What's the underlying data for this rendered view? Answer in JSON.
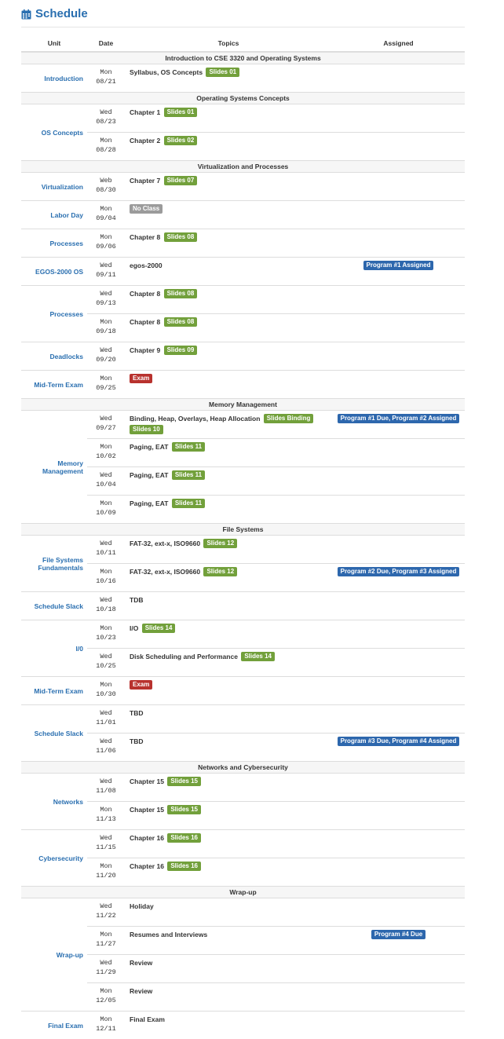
{
  "header": {
    "title": "Schedule",
    "icon": "calendar-icon",
    "accent": "#2a6fb0"
  },
  "columns": {
    "unit": "Unit",
    "date": "Date",
    "topics": "Topics",
    "assigned": "Assigned"
  },
  "colors": {
    "slides": "#72a03b",
    "no_class": "#9b9b9b",
    "exam": "#b8322e",
    "program": "#2d67ad"
  },
  "sections": {
    "s1": "Introduction to CSE 3320 and Operating Systems",
    "s2": "Operating Systems Concepts",
    "s3": "Virtualization and Processes",
    "s4": "Memory Management",
    "s5": "File Systems",
    "s6": "Networks and Cybersecurity",
    "s7": "Wrap-up"
  },
  "units": {
    "u1": "Introduction",
    "u2": "OS Concepts",
    "u3": "Virtualization",
    "u4": "Labor Day",
    "u5": "Processes",
    "u6": "EGOS-2000 OS",
    "u7": "Processes",
    "u8": "Deadlocks",
    "u9": "Mid-Term Exam",
    "u10a": "Memory",
    "u10b": "Management",
    "u11a": "File Systems",
    "u11b": "Fundamentals",
    "u12": "Schedule Slack",
    "u13": "I/0",
    "u14": "Mid-Term Exam",
    "u15": "Schedule Slack",
    "u16": "Networks",
    "u17": "Cybersecurity",
    "u18": "Wrap-up",
    "u19": "Final Exam"
  },
  "rows": {
    "r1": {
      "day": "Mon",
      "date": "08/21",
      "topic": "Syllabus, OS Concepts",
      "label": "Slides 01"
    },
    "r2": {
      "day": "Wed",
      "date": "08/23",
      "topic": "Chapter 1",
      "label": "Slides 01"
    },
    "r3": {
      "day": "Mon",
      "date": "08/28",
      "topic": "Chapter 2",
      "label": "Slides 02"
    },
    "r4": {
      "day": "Web",
      "date": "08/30",
      "topic": "Chapter 7",
      "label": "Slides 07"
    },
    "r5": {
      "day": "Mon",
      "date": "09/04",
      "label": "No Class"
    },
    "r6": {
      "day": "Mon",
      "date": "09/06",
      "topic": "Chapter 8",
      "label": "Slides 08"
    },
    "r7": {
      "day": "Wed",
      "date": "09/11",
      "topic": "egos-2000",
      "assigned": "Program #1 Assigned"
    },
    "r8": {
      "day": "Wed",
      "date": "09/13",
      "topic": "Chapter 8",
      "label": "Slides 08"
    },
    "r9": {
      "day": "Mon",
      "date": "09/18",
      "topic": "Chapter 8",
      "label": "Slides 08"
    },
    "r10": {
      "day": "Wed",
      "date": "09/20",
      "topic": "Chapter 9",
      "label": "Slides 09"
    },
    "r11": {
      "day": "Mon",
      "date": "09/25",
      "label": "Exam"
    },
    "r12": {
      "day": "Wed",
      "date": "09/27",
      "topic": "Binding, Heap, Overlays, Heap Allocation",
      "label": "Slides Binding",
      "label2": "Slides 10",
      "assigned": "Program #1 Due, Program #2 Assigned"
    },
    "r13": {
      "day": "Mon",
      "date": "10/02",
      "topic": "Paging, EAT",
      "label": "Slides 11"
    },
    "r14": {
      "day": "Wed",
      "date": "10/04",
      "topic": "Paging, EAT",
      "label": "Slides 11"
    },
    "r15": {
      "day": "Mon",
      "date": "10/09",
      "topic": "Paging, EAT",
      "label": "Slides 11"
    },
    "r16": {
      "day": "Wed",
      "date": "10/11",
      "topic": "FAT-32, ext-x, ISO9660",
      "label": "Slides 12"
    },
    "r17": {
      "day": "Mon",
      "date": "10/16",
      "topic": "FAT-32, ext-x, ISO9660",
      "label": "Slides 12",
      "assigned": "Program #2 Due, Program #3 Assigned"
    },
    "r18": {
      "day": "Wed",
      "date": "10/18",
      "topic": "TDB"
    },
    "r19": {
      "day": "Mon",
      "date": "10/23",
      "topic": "I/O",
      "label": "Slides 14"
    },
    "r20": {
      "day": "Wed",
      "date": "10/25",
      "topic": "Disk Scheduling and Performance",
      "label": "Slides 14"
    },
    "r21": {
      "day": "Mon",
      "date": "10/30",
      "label": "Exam"
    },
    "r22": {
      "day": "Wed",
      "date": "11/01",
      "topic": "TBD"
    },
    "r23": {
      "day": "Wed",
      "date": "11/06",
      "topic": "TBD",
      "assigned": "Program #3 Due, Program #4 Assigned"
    },
    "r24": {
      "day": "Wed",
      "date": "11/08",
      "topic": "Chapter 15",
      "label": "Slides 15"
    },
    "r25": {
      "day": "Mon",
      "date": "11/13",
      "topic": "Chapter 15",
      "label": "Slides 15"
    },
    "r26": {
      "day": "Wed",
      "date": "11/15",
      "topic": "Chapter 16",
      "label": "Slides 16"
    },
    "r27": {
      "day": "Mon",
      "date": "11/20",
      "topic": "Chapter 16",
      "label": "Slides 16"
    },
    "r28": {
      "day": "Wed",
      "date": "11/22",
      "topic": "Holiday"
    },
    "r29": {
      "day": "Mon",
      "date": "11/27",
      "topic": "Resumes and Interviews",
      "assigned": "Program #4 Due"
    },
    "r30": {
      "day": "Wed",
      "date": "11/29",
      "topic": "Review"
    },
    "r31": {
      "day": "Mon",
      "date": "12/05",
      "topic": "Review"
    },
    "r32": {
      "day": "Mon",
      "date": "12/11",
      "topic": "Final Exam"
    }
  }
}
